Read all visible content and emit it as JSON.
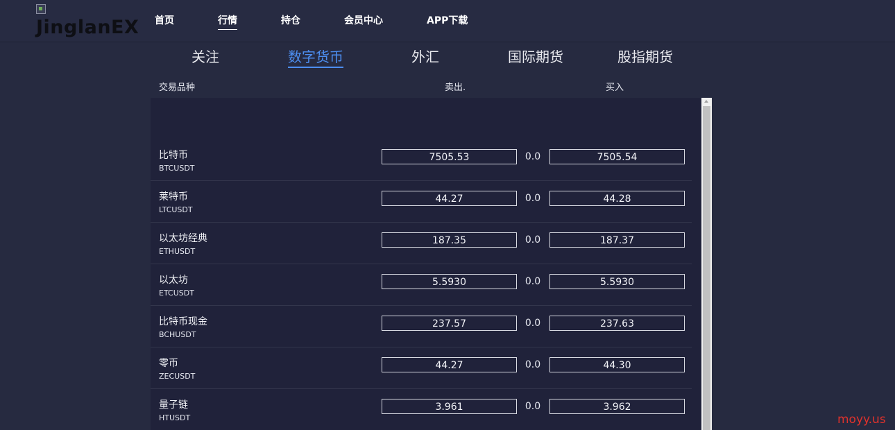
{
  "header": {
    "logo_text": "JinglanEX",
    "nav": [
      {
        "label": "首页",
        "active": false
      },
      {
        "label": "行情",
        "active": true
      },
      {
        "label": "持仓",
        "active": false
      },
      {
        "label": "会员中心",
        "active": false
      },
      {
        "label": "APP下载",
        "active": false
      }
    ]
  },
  "tabs": [
    {
      "label": "关注",
      "active": false
    },
    {
      "label": "数字货币",
      "active": true
    },
    {
      "label": "外汇",
      "active": false
    },
    {
      "label": "国际期货",
      "active": false
    },
    {
      "label": "股指期货",
      "active": false
    }
  ],
  "columns": {
    "symbol": "交易品种",
    "sell": "卖出.",
    "buy": "买入"
  },
  "rows": [
    {
      "name": "比特币",
      "code": "BTCUSDT",
      "sell": "7505.53",
      "change": "0.0",
      "buy": "7505.54"
    },
    {
      "name": "莱特币",
      "code": "LTCUSDT",
      "sell": "44.27",
      "change": "0.0",
      "buy": "44.28"
    },
    {
      "name": "以太坊经典",
      "code": "ETHUSDT",
      "sell": "187.35",
      "change": "0.0",
      "buy": "187.37"
    },
    {
      "name": "以太坊",
      "code": "ETCUSDT",
      "sell": "5.5930",
      "change": "0.0",
      "buy": "5.5930"
    },
    {
      "name": "比特币现金",
      "code": "BCHUSDT",
      "sell": "237.57",
      "change": "0.0",
      "buy": "237.63"
    },
    {
      "name": "零币",
      "code": "ZECUSDT",
      "sell": "44.27",
      "change": "0.0",
      "buy": "44.30"
    },
    {
      "name": "量子链",
      "code": "HTUSDT",
      "sell": "3.961",
      "change": "0.0",
      "buy": "3.962"
    }
  ],
  "watermark": "moyy.us",
  "colors": {
    "accent": "#4d8ef0",
    "background": "#262a40",
    "panel": "#20223a",
    "watermark": "#e0322c"
  }
}
